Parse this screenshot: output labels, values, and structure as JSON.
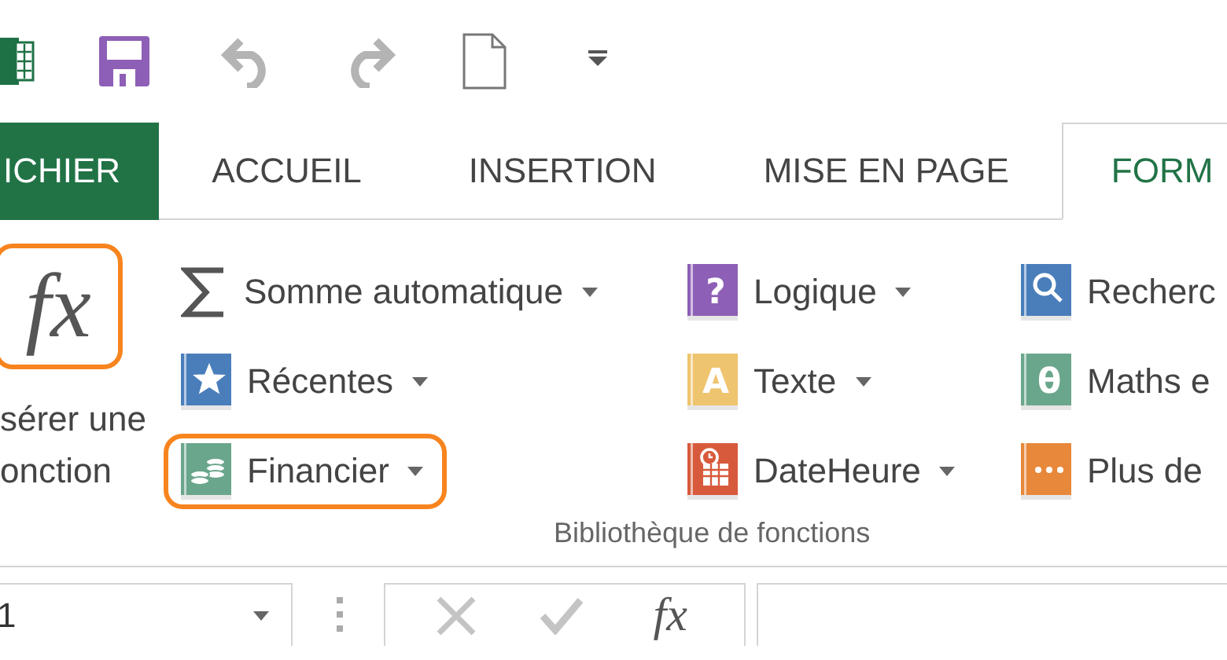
{
  "quick_access": [
    {
      "kind": "app_logo",
      "disabled": false
    },
    {
      "kind": "save",
      "disabled": false
    },
    {
      "kind": "undo",
      "disabled": true
    },
    {
      "kind": "redo",
      "disabled": true
    },
    {
      "kind": "new",
      "disabled": false
    },
    {
      "kind": "customize",
      "disabled": false
    }
  ],
  "tabs": [
    {
      "label": "ICHIER",
      "kind": "file",
      "selected": false
    },
    {
      "label": "ACCUEIL",
      "kind": "tab",
      "selected": false
    },
    {
      "label": "INSERTION",
      "kind": "tab",
      "selected": false
    },
    {
      "label": "MISE EN PAGE",
      "kind": "tab",
      "selected": false
    },
    {
      "label": "FORM",
      "kind": "tab",
      "selected": true
    }
  ],
  "insert_function": {
    "symbol": "fx",
    "label": "sérer une\nonction",
    "highlighted": true
  },
  "commands": [
    [
      {
        "label": "Somme automatique",
        "kind": "sigma",
        "dropdown": true,
        "highlighted": false
      },
      {
        "label": "Récentes",
        "kind": "star",
        "color": "#4a7ebb",
        "dropdown": true,
        "highlighted": false
      },
      {
        "label": "Financier",
        "kind": "coins",
        "color": "#6aa68b",
        "dropdown": true,
        "highlighted": true
      }
    ],
    [
      {
        "label": "Logique",
        "kind": "glyph",
        "glyph": "?",
        "color": "#8e5fb6",
        "dropdown": true,
        "highlighted": false
      },
      {
        "label": "Texte",
        "kind": "glyph",
        "glyph": "A",
        "color": "#efc46e",
        "dropdown": true,
        "highlighted": false
      },
      {
        "label": "DateHeure",
        "kind": "calendar",
        "color": "#d85a3c",
        "dropdown": true,
        "highlighted": false
      }
    ],
    [
      {
        "label": "Recherc",
        "kind": "magnifier",
        "color": "#4a7ebb",
        "highlighted": false
      },
      {
        "label": "Maths e",
        "kind": "glyph",
        "glyph": "θ",
        "color": "#6aa68b",
        "highlighted": false
      },
      {
        "label": "Plus de",
        "kind": "dots",
        "color": "#e8883a",
        "highlighted": false
      }
    ]
  ],
  "group_label": "Bibliothèque de fonctions",
  "formula_bar": {
    "name_box": "1",
    "cancel_disabled": true,
    "enter_disabled": true,
    "function_symbol": "fx"
  }
}
